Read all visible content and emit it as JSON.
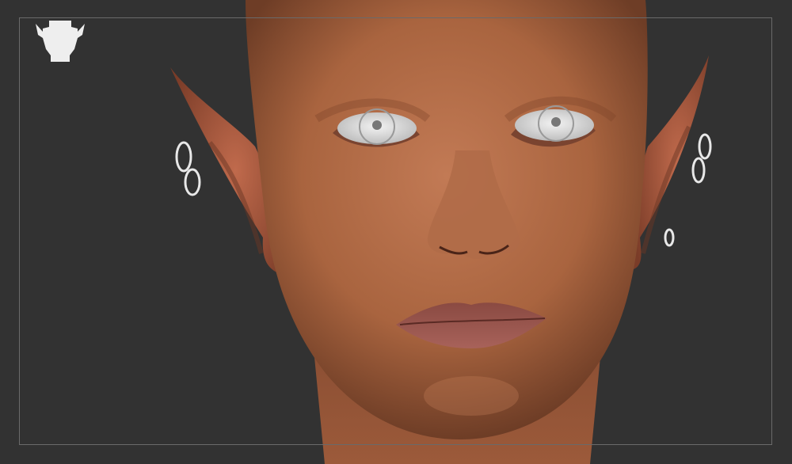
{
  "app": {
    "viewport_background": "#323232",
    "frame_border_color": "#6a6a6a"
  },
  "navigation": {
    "head_icon": "head-silhouette-icon",
    "icon_color": "#eeeeee"
  },
  "model": {
    "skin_color": "#b8704e",
    "skin_shadow_color": "#7a4630",
    "ear_inner_color": "#b85a45",
    "eye_color": "#e3e3e3",
    "lip_color": "#9a5a50",
    "earring_color": "#e8e8e8"
  }
}
